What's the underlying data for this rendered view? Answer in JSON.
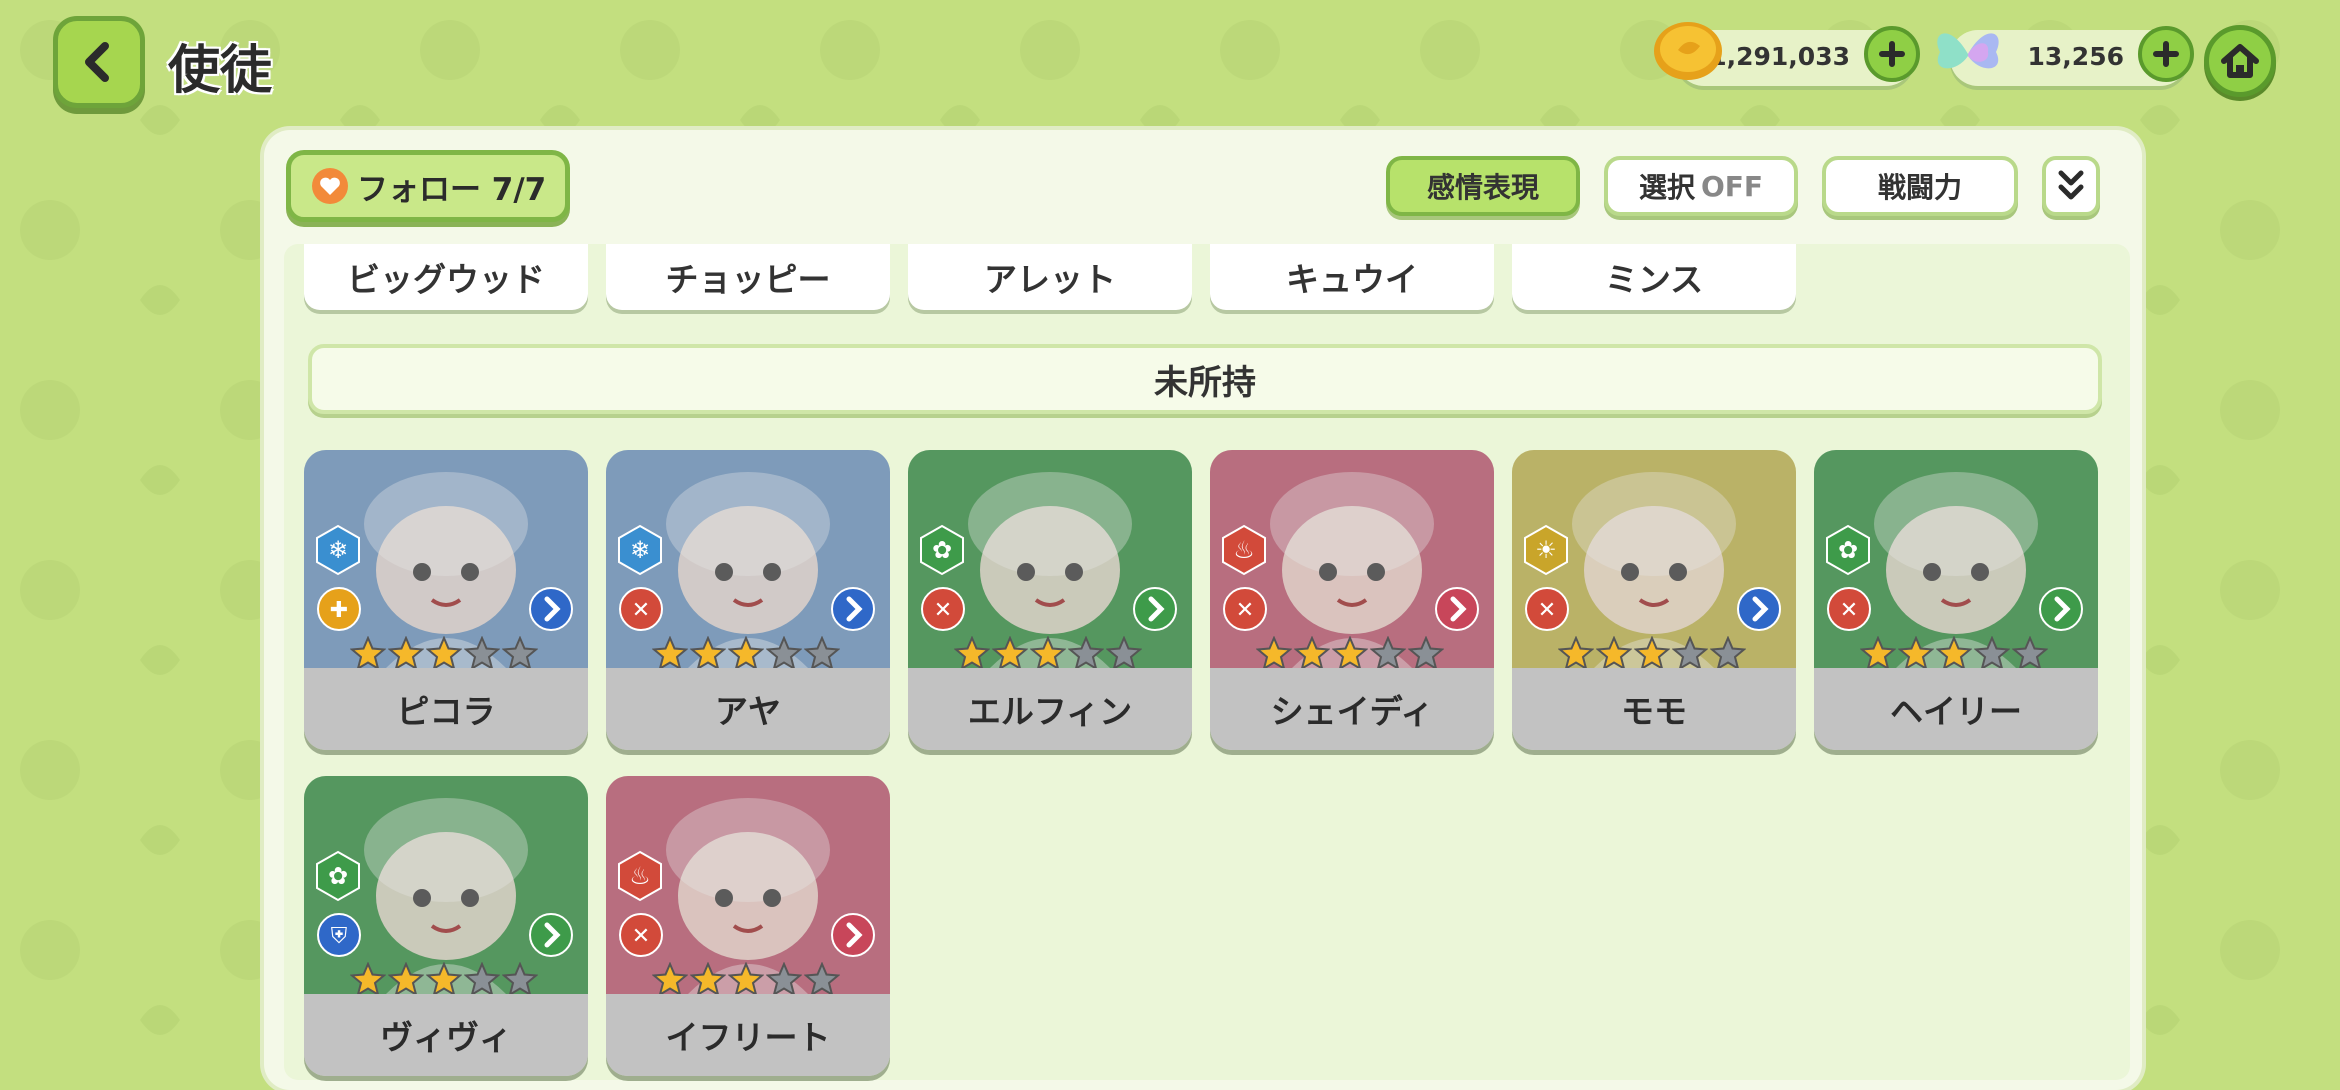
{
  "header": {
    "title": "使徒"
  },
  "currency": {
    "gold_amount": "1,291,033",
    "gem_amount": "13,256"
  },
  "toolbar": {
    "follow_label": "フォロー 7/7",
    "emotion_label": "感情表現",
    "select_label": "選択",
    "select_state": "OFF",
    "power_label": "戦闘力"
  },
  "owned_names": [
    "ビッグウッド",
    "チョッピー",
    "アレット",
    "キュウイ",
    "ミンス"
  ],
  "section": {
    "unowned_label": "未所持"
  },
  "cards": [
    {
      "name": "ピコラ",
      "element": "ice",
      "role": "support",
      "stars": 3,
      "bg": "#7fa3c9"
    },
    {
      "name": "アヤ",
      "element": "ice",
      "role": "attack",
      "stars": 3,
      "bg": "#7fa3c9"
    },
    {
      "name": "エルフィン",
      "element": "nature",
      "role": "attack",
      "stars": 3,
      "bg": "#4e9e5a"
    },
    {
      "name": "シェイディ",
      "element": "fire",
      "role": "attack",
      "stars": 3,
      "bg": "#c66c80"
    },
    {
      "name": "モモ",
      "element": "light",
      "role": "attack",
      "stars": 3,
      "bg": "#c9bf63"
    },
    {
      "name": "ヘイリー",
      "element": "nature",
      "role": "attack",
      "stars": 3,
      "bg": "#4e9e5a"
    },
    {
      "name": "ヴィヴィ",
      "element": "nature",
      "role": "defense",
      "stars": 3,
      "bg": "#4e9e5a"
    },
    {
      "name": "イフリート",
      "element": "fire",
      "role": "attack",
      "stars": 3,
      "bg": "#c66c80"
    }
  ],
  "colors": {
    "background": "#c3df7f",
    "accent": "#8fcf45",
    "panel": "#f4f9e8"
  }
}
